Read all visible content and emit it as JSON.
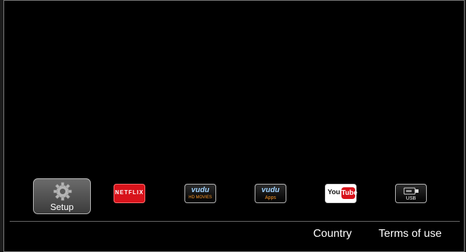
{
  "apps": [
    {
      "label": "Setup",
      "icon": "gear-icon",
      "selected": true
    },
    {
      "label": "NETFLIX",
      "icon": "netflix-logo"
    },
    {
      "label": "vudu",
      "sublabel": "HD MOVIES",
      "icon": "vudu-logo"
    },
    {
      "label": "vudu",
      "sublabel": "Apps",
      "icon": "vudu-logo"
    },
    {
      "you": "You",
      "tube": "Tube",
      "icon": "youtube-logo"
    },
    {
      "label": "USB",
      "icon": "usb-icon"
    }
  ],
  "footer": {
    "country_label": "Country",
    "terms_label": "Terms of use"
  },
  "colors": {
    "background": "#000000",
    "selected_tile": "#5a5a5a",
    "netflix_red": "#d8131b",
    "vudu_blue": "#9fd2ff",
    "vudu_orange": "#ff9a2a"
  }
}
